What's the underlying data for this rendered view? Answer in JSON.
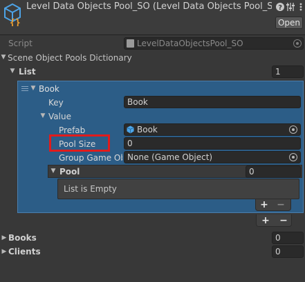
{
  "header": {
    "title": "Level Data Objects Pool_SO (Level Data Objects Pool_SO",
    "icons": [
      "help-icon",
      "settings-sliders-icon",
      "more-options-icon"
    ],
    "open_label": "Open"
  },
  "script_row": {
    "label": "Script",
    "value": "LevelDataObjectsPool_SO"
  },
  "dictionary": {
    "label": "Scene Object Pools Dictionary",
    "list": {
      "label": "List",
      "size": "1",
      "element": {
        "label": "Book",
        "key_label": "Key",
        "key_value": "Book",
        "value_label": "Value",
        "prefab_label": "Prefab",
        "prefab_value": "Book",
        "pool_size_label": "Pool Size",
        "pool_size_value": "0",
        "group_label": "Group Game Obj",
        "group_value": "None (Game Object)",
        "pool_label": "Pool",
        "pool_size": "0",
        "pool_empty": "List is Empty"
      }
    }
  },
  "buttons": {
    "add": "+",
    "remove": "−"
  },
  "books": {
    "label": "Books",
    "value": "0"
  },
  "clients": {
    "label": "Clients",
    "value": "0"
  },
  "colors": {
    "selected": "#2c5d87",
    "highlight": "#e21b1b",
    "background": "#383838"
  }
}
